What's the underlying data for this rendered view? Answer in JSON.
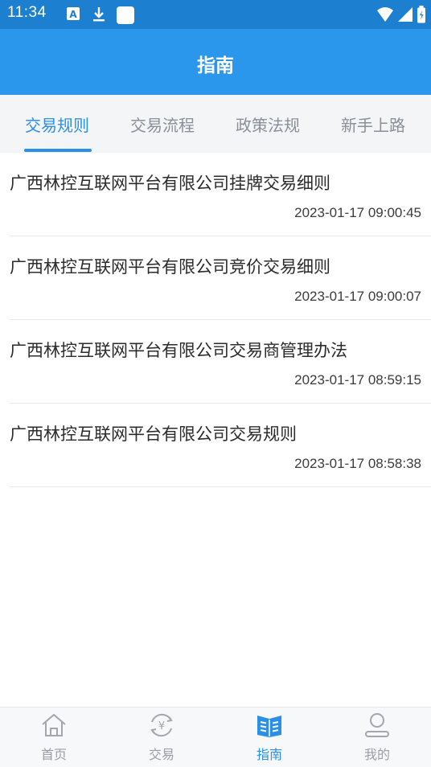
{
  "status_bar": {
    "time": "11:34",
    "icons": [
      "a-icon",
      "download-icon",
      "square-icon",
      "wifi-icon",
      "signal-icon",
      "battery-icon"
    ]
  },
  "header": {
    "title": "指南",
    "background": "#2a96ec"
  },
  "tabs": [
    {
      "label": "交易规则",
      "active": true
    },
    {
      "label": "交易流程",
      "active": false
    },
    {
      "label": "政策法规",
      "active": false
    },
    {
      "label": "新手上路",
      "active": false
    }
  ],
  "list": [
    {
      "title": "广西林控互联网平台有限公司挂牌交易细则",
      "time": "2023-01-17 09:00:45"
    },
    {
      "title": "广西林控互联网平台有限公司竞价交易细则",
      "time": "2023-01-17 09:00:07"
    },
    {
      "title": "广西林控互联网平台有限公司交易商管理办法",
      "time": "2023-01-17 08:59:15"
    },
    {
      "title": "广西林控互联网平台有限公司交易规则",
      "time": "2023-01-17 08:58:38"
    }
  ],
  "bottom_nav": [
    {
      "label": "首页",
      "icon": "home-icon",
      "active": false
    },
    {
      "label": "交易",
      "icon": "yuan-exchange-icon",
      "active": false
    },
    {
      "label": "指南",
      "icon": "guide-book-icon",
      "active": true
    },
    {
      "label": "我的",
      "icon": "user-icon",
      "active": false
    }
  ],
  "colors": {
    "status_bar": "#1c7fd0",
    "accent": "#2a8fe6",
    "inactive": "#9a9ea4"
  }
}
